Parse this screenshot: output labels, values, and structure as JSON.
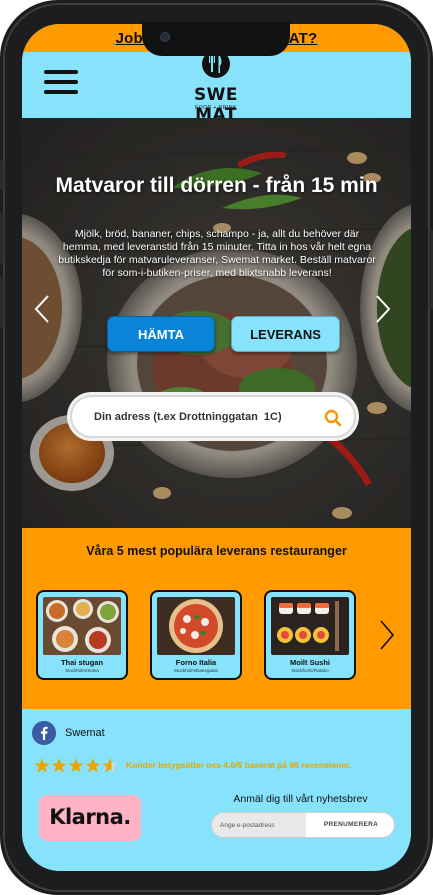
{
  "top_banner": {
    "link": "Jobba hos oss? SWE MAT?"
  },
  "header": {
    "menu_icon": "hamburger-icon",
    "logo": {
      "name": "SWE MAT",
      "tagline": "FOOD + DRINK"
    }
  },
  "hero": {
    "title": "Matvaror till dörren - från 15 min",
    "text": "Mjölk, bröd, bananer, chips, schampo - ja, allt du behöver där hemma, med leveranstid från 15 minuter. Titta in hos vår helt egna butikskedja för matvaruleveranser, Swemat market. Beställ matvaror för som-i-butiken-priser, med blixtsnabb leverans!",
    "btn_pickup": "HÄMTA",
    "btn_delivery": "LEVERANS",
    "search_placeholder": "Din adress (t.ex Drottninggatan  1C)"
  },
  "popular": {
    "title": "Våra 5 mest populära leverans restauranger",
    "restaurants": [
      {
        "name": "Thai stugan",
        "sub": "Stockholm/Solna"
      },
      {
        "name": "Forno Italia",
        "sub": "Stockholm/Danegatan"
      },
      {
        "name": "Moilt Sushi",
        "sub": "Stockholm/Flatabo"
      }
    ]
  },
  "footer": {
    "facebook_label": "Swemat",
    "rating": 4.6,
    "rating_text": "Kunder betygsätter oss 4.6/5 baserat på 86 recensioner.",
    "klarna": "Klarna.",
    "newsletter_title": "Anmäl dig till vårt nyhetsbrev",
    "email_placeholder": "Ange e-postadress",
    "subscribe_label": "PRENUMERERA"
  },
  "colors": {
    "orange": "#ff9a00",
    "sky": "#86e3fb",
    "blue": "#0b83d6",
    "klarna_pink": "#ffb3c7",
    "star": "#e6a500"
  }
}
